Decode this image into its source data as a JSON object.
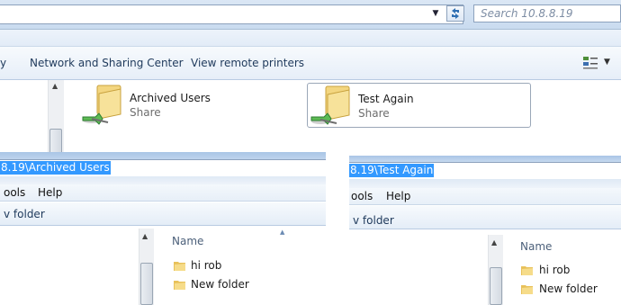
{
  "top": {
    "search_placeholder": "Search 10.8.8.19",
    "address_text": ""
  },
  "command_bar": {
    "items": [
      "Network and Sharing Center",
      "View remote printers"
    ],
    "left_partial": "y"
  },
  "shares": [
    {
      "name": "Archived Users",
      "sub": "Share",
      "selected": false
    },
    {
      "name": "Test Again",
      "sub": "Share",
      "selected": true
    }
  ],
  "left_window": {
    "address": "8.19\\Archived Users",
    "menu": [
      "ools",
      "Help"
    ],
    "toolbar_partial": "v folder",
    "column": "Name",
    "items": [
      "hi rob",
      "New folder"
    ]
  },
  "right_window": {
    "address": "8.19\\Test Again",
    "menu": [
      "ools",
      "Help"
    ],
    "toolbar_partial": "v folder",
    "column": "Name",
    "items": [
      "hi rob",
      "New folder"
    ]
  },
  "colors": {
    "selection": "#3399ff",
    "folder": "#f1cf67"
  }
}
